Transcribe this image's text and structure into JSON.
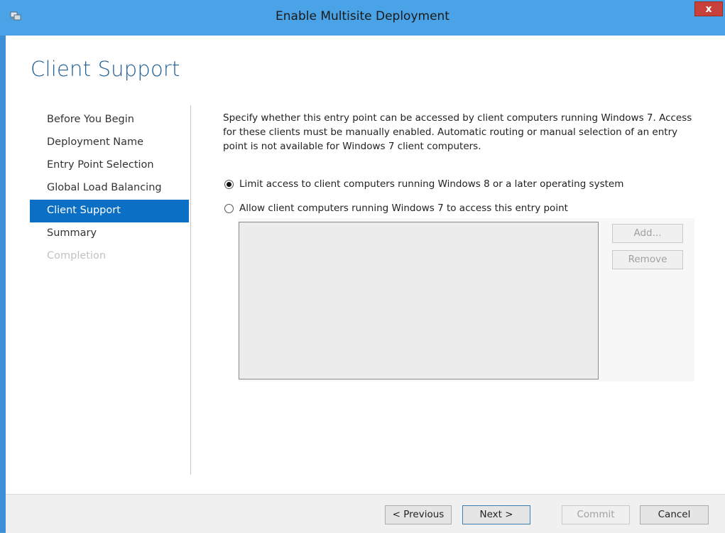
{
  "window": {
    "title": "Enable Multisite Deployment",
    "close_label": "x"
  },
  "page": {
    "title": "Client Support"
  },
  "nav": {
    "items": [
      {
        "label": "Before You Begin",
        "state": "normal"
      },
      {
        "label": "Deployment Name",
        "state": "normal"
      },
      {
        "label": "Entry Point Selection",
        "state": "normal"
      },
      {
        "label": "Global Load Balancing",
        "state": "normal"
      },
      {
        "label": "Client Support",
        "state": "active"
      },
      {
        "label": "Summary",
        "state": "normal"
      },
      {
        "label": "Completion",
        "state": "disabled"
      }
    ]
  },
  "content": {
    "description": "Specify whether this entry point can be accessed by client computers running Windows 7. Access for these clients must be manually enabled. Automatic routing or manual selection of an entry point is not available for Windows 7 client computers.",
    "options": [
      {
        "label": "Limit access to client computers running Windows 8 or a later operating system",
        "checked": true
      },
      {
        "label": "Allow client computers running Windows 7 to access this entry point",
        "checked": false
      }
    ],
    "add_label": "Add...",
    "remove_label": "Remove"
  },
  "footer": {
    "previous_label": "< Previous",
    "next_label": "Next >",
    "commit_label": "Commit",
    "cancel_label": "Cancel"
  },
  "colors": {
    "title_bar": "#4aa3e6",
    "accent": "#0b6fc6",
    "page_title": "#1f5f97",
    "close_button": "#c7413a"
  }
}
